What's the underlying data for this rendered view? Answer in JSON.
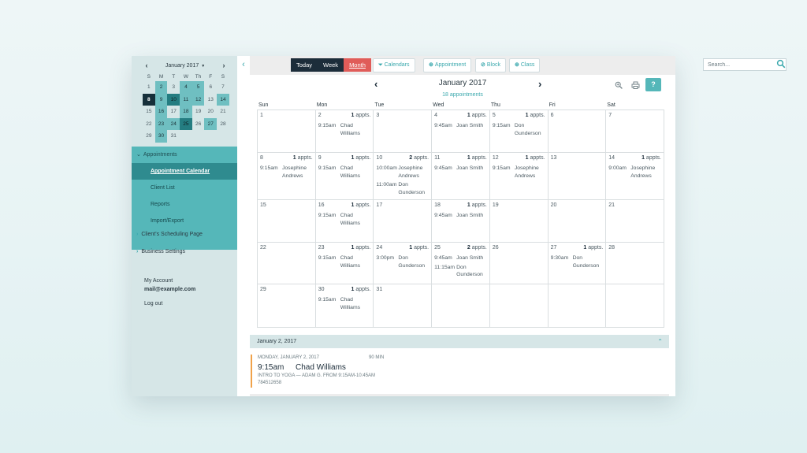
{
  "sidebar": {
    "mini_calendar": {
      "title": "January 2017",
      "prev": "‹",
      "next": "›",
      "weekdays": [
        "S",
        "M",
        "T",
        "W",
        "Th",
        "F",
        "S"
      ],
      "weeks": [
        [
          {
            "d": "1",
            "s": 0
          },
          {
            "d": "2",
            "s": 1
          },
          {
            "d": "3",
            "s": 0
          },
          {
            "d": "4",
            "s": 1
          },
          {
            "d": "5",
            "s": 1
          },
          {
            "d": "6",
            "s": 0
          },
          {
            "d": "7",
            "s": 0
          }
        ],
        [
          {
            "d": "8",
            "s": 4
          },
          {
            "d": "9",
            "s": 1
          },
          {
            "d": "10",
            "s": 3
          },
          {
            "d": "11",
            "s": 1
          },
          {
            "d": "12",
            "s": 1
          },
          {
            "d": "13",
            "s": 0
          },
          {
            "d": "14",
            "s": 1
          }
        ],
        [
          {
            "d": "15",
            "s": 0
          },
          {
            "d": "16",
            "s": 1
          },
          {
            "d": "17",
            "s": 0
          },
          {
            "d": "18",
            "s": 1
          },
          {
            "d": "19",
            "s": 0
          },
          {
            "d": "20",
            "s": 0
          },
          {
            "d": "21",
            "s": 0
          }
        ],
        [
          {
            "d": "22",
            "s": 0
          },
          {
            "d": "23",
            "s": 1
          },
          {
            "d": "24",
            "s": 1
          },
          {
            "d": "25",
            "s": 3
          },
          {
            "d": "26",
            "s": 0
          },
          {
            "d": "27",
            "s": 1
          },
          {
            "d": "28",
            "s": 0
          }
        ],
        [
          {
            "d": "29",
            "s": 0
          },
          {
            "d": "30",
            "s": 1
          },
          {
            "d": "31",
            "s": 0
          }
        ]
      ]
    },
    "nav": {
      "appointments": "Appointments",
      "items": [
        {
          "label": "Appointment Calendar",
          "active": true
        },
        {
          "label": "Client List",
          "active": false
        },
        {
          "label": "Reports",
          "active": false
        },
        {
          "label": "Import/Export",
          "active": false
        }
      ],
      "scheduling_page": "Client's Scheduling Page",
      "business_settings": "Business Settings"
    },
    "account": {
      "my_account": "My Account",
      "email": "mail@example.com",
      "log_out": "Log out"
    }
  },
  "toolbar": {
    "views": [
      "Today",
      "Week",
      "Month"
    ],
    "active_view": "Month",
    "calendars": "Calendars",
    "appointment": "Appointment",
    "block": "Block",
    "class": "Class",
    "search_placeholder": "Search..."
  },
  "calendar": {
    "title": "January 2017",
    "count": "18 appointments",
    "help": "?",
    "weekdays": [
      "Sun",
      "Mon",
      "Tue",
      "Wed",
      "Thu",
      "Fri",
      "Sat"
    ],
    "cells": [
      {
        "d": "1"
      },
      {
        "d": "2",
        "n": "1",
        "a": [
          {
            "t": "9:15am",
            "who": "Chad Williams"
          }
        ]
      },
      {
        "d": "3"
      },
      {
        "d": "4",
        "n": "1",
        "a": [
          {
            "t": "9:45am",
            "who": "Joan Smith"
          }
        ]
      },
      {
        "d": "5",
        "n": "1",
        "a": [
          {
            "t": "9:15am",
            "who": "Don Gunderson"
          }
        ]
      },
      {
        "d": "6"
      },
      {
        "d": "7"
      },
      {
        "d": "8",
        "n": "1",
        "a": [
          {
            "t": "9:15am",
            "who": "Josephine Andrews"
          }
        ]
      },
      {
        "d": "9",
        "n": "1",
        "a": [
          {
            "t": "9:15am",
            "who": "Chad Williams"
          }
        ]
      },
      {
        "d": "10",
        "n": "2",
        "a": [
          {
            "t": "10:00am",
            "who": "Josephine Andrews"
          },
          {
            "t": "11:00am",
            "who": "Don Gunderson"
          }
        ]
      },
      {
        "d": "11",
        "n": "1",
        "a": [
          {
            "t": "9:45am",
            "who": "Joan Smith"
          }
        ]
      },
      {
        "d": "12",
        "n": "1",
        "a": [
          {
            "t": "9:15am",
            "who": "Josephine Andrews"
          }
        ]
      },
      {
        "d": "13"
      },
      {
        "d": "14",
        "n": "1",
        "a": [
          {
            "t": "9:00am",
            "who": "Josephine Andrews"
          }
        ]
      },
      {
        "d": "15"
      },
      {
        "d": "16",
        "n": "1",
        "a": [
          {
            "t": "9:15am",
            "who": "Chad Williams"
          }
        ]
      },
      {
        "d": "17"
      },
      {
        "d": "18",
        "n": "1",
        "a": [
          {
            "t": "9:45am",
            "who": "Joan Smith"
          }
        ]
      },
      {
        "d": "19"
      },
      {
        "d": "20"
      },
      {
        "d": "21"
      },
      {
        "d": "22"
      },
      {
        "d": "23",
        "n": "1",
        "a": [
          {
            "t": "9:15am",
            "who": "Chad Williams"
          }
        ]
      },
      {
        "d": "24",
        "n": "1",
        "a": [
          {
            "t": "3:00pm",
            "who": "Don Gunderson"
          }
        ]
      },
      {
        "d": "25",
        "n": "2",
        "a": [
          {
            "t": "9:45am",
            "who": "Joan Smith"
          },
          {
            "t": "11:15am",
            "who": "Don Gunderson"
          }
        ]
      },
      {
        "d": "26"
      },
      {
        "d": "27",
        "n": "1",
        "a": [
          {
            "t": "9:30am",
            "who": "Don Gunderson"
          }
        ]
      },
      {
        "d": "28"
      },
      {
        "d": "29"
      },
      {
        "d": "30",
        "n": "1",
        "a": [
          {
            "t": "9:15am",
            "who": "Chad Williams"
          }
        ]
      },
      {
        "d": "31"
      },
      {
        "d": ""
      },
      {
        "d": ""
      },
      {
        "d": ""
      },
      {
        "d": ""
      }
    ],
    "appts_suffix": "appts."
  },
  "detail": {
    "day_label": "January 2, 2017",
    "date_line": "MONDAY, JANUARY 2, 2017",
    "duration": "90 MIN",
    "time": "9:15am",
    "name": "Chad Williams",
    "description": "INTRO TO YOGA — ADAM G. FROM 9:15AM-10:45AM",
    "phone": "784512658"
  },
  "colors": {
    "teal": "#55b7b9",
    "dark": "#1c2d3a",
    "month_active": "#e05c59",
    "accent_orange": "#f0a24a"
  }
}
